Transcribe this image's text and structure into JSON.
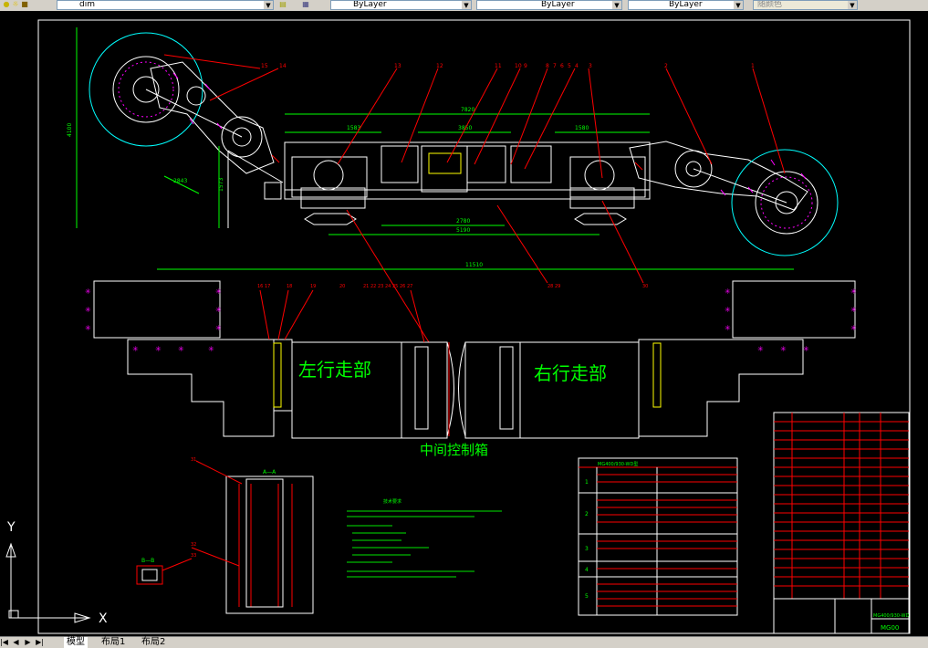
{
  "toolbar": {
    "layer_name": "dim",
    "linetype_value": "ByLayer",
    "lineweight_value": "ByLayer",
    "plotstyle_value": "ByLayer",
    "color_value": "随颜色"
  },
  "drawing": {
    "label_left": "左行走部",
    "label_right": "右行走部",
    "label_center": "中间控制箱",
    "dim_7820": "7820",
    "dim_1583": "1583",
    "dim_3850": "3850",
    "dim_1580": "1580",
    "dim_2780": "2780",
    "dim_5190": "5190",
    "dim_11510": "11510",
    "dim_4100": "4100",
    "dim_2843": "2843",
    "dim_1573": "1573",
    "callouts_top": [
      "15",
      "14",
      "13",
      "12",
      "11",
      "10",
      "9",
      "8",
      "7",
      "6",
      "5",
      "4",
      "3",
      "2",
      "1"
    ],
    "callouts_mid": [
      "16",
      "17",
      "18",
      "19",
      "20",
      "21",
      "22",
      "23",
      "24",
      "25",
      "26",
      "27",
      "28",
      "29",
      "30"
    ],
    "section_aa": "A—A",
    "section_bb": "B—B",
    "callout_31": "31",
    "callout_32": "32",
    "callout_33": "33",
    "notes_title": "技术要求",
    "table_title": "MG400/930-WD型",
    "table_rows": [
      "1",
      "2",
      "3",
      "4",
      "5"
    ],
    "title_block_name": "MG400/930-WD",
    "title_block_short": "MG00"
  },
  "ucs": {
    "y_label": "Y",
    "x_label": "X"
  },
  "tabs": {
    "model": "模型",
    "layout1": "布局1",
    "layout2": "布局2"
  },
  "colors": {
    "cad_bg": "#000000",
    "green": "#00ff00",
    "red": "#ff0000",
    "magenta": "#ff00ff",
    "cyan": "#00ffff",
    "white": "#ffffff"
  }
}
